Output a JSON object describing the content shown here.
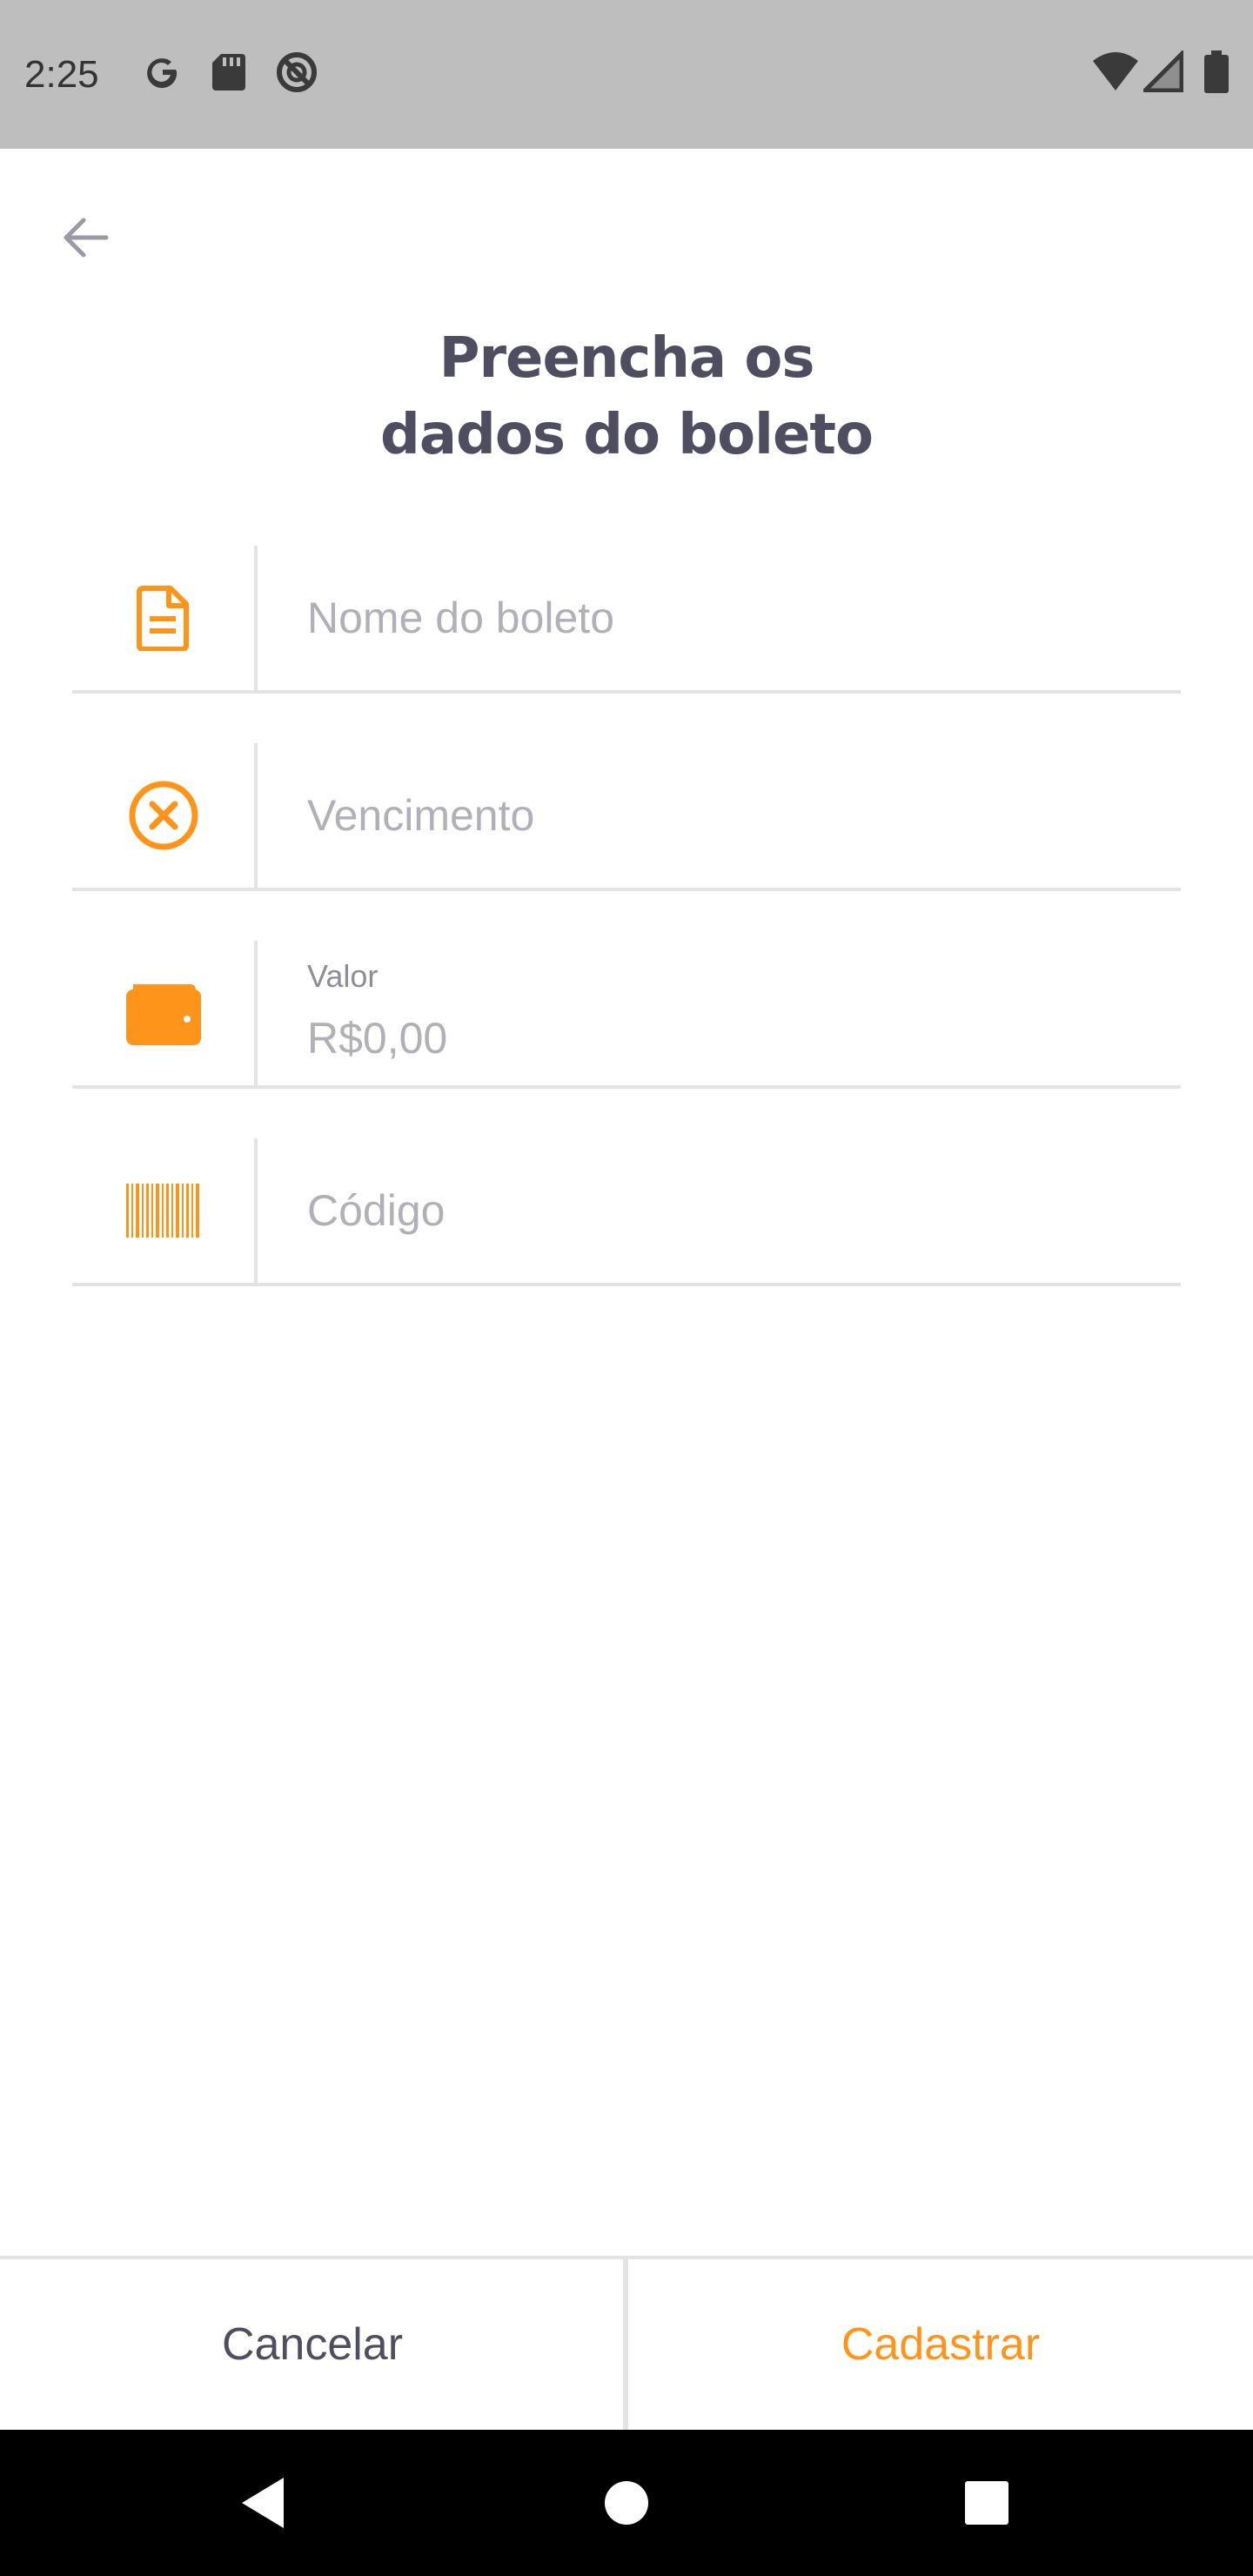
{
  "status_bar": {
    "time": "2:25",
    "icons": [
      "google-icon",
      "sd-card-icon",
      "no-disturb-icon",
      "wifi-icon",
      "signal-icon",
      "battery-icon"
    ]
  },
  "header": {
    "back_icon": "arrow-left-icon",
    "title_line1": "Preencha os",
    "title_line2": "dados do boleto"
  },
  "form": {
    "name": {
      "placeholder": "Nome do boleto",
      "value": "",
      "icon": "file-text-icon"
    },
    "due_date": {
      "placeholder": "Vencimento",
      "value": "",
      "icon": "x-circle-icon"
    },
    "amount": {
      "label": "Valor",
      "placeholder": "R$0,00",
      "value": "",
      "icon": "wallet-icon"
    },
    "code": {
      "placeholder": "Código",
      "value": "",
      "icon": "barcode-icon"
    }
  },
  "actions": {
    "cancel_label": "Cancelar",
    "register_label": "Cadastrar"
  },
  "colors": {
    "accent": "#ff941a",
    "heading": "#4f4d60",
    "placeholder": "#b1b0b8",
    "divider": "#e3e3e6",
    "status_bar_bg": "#bebebe"
  }
}
